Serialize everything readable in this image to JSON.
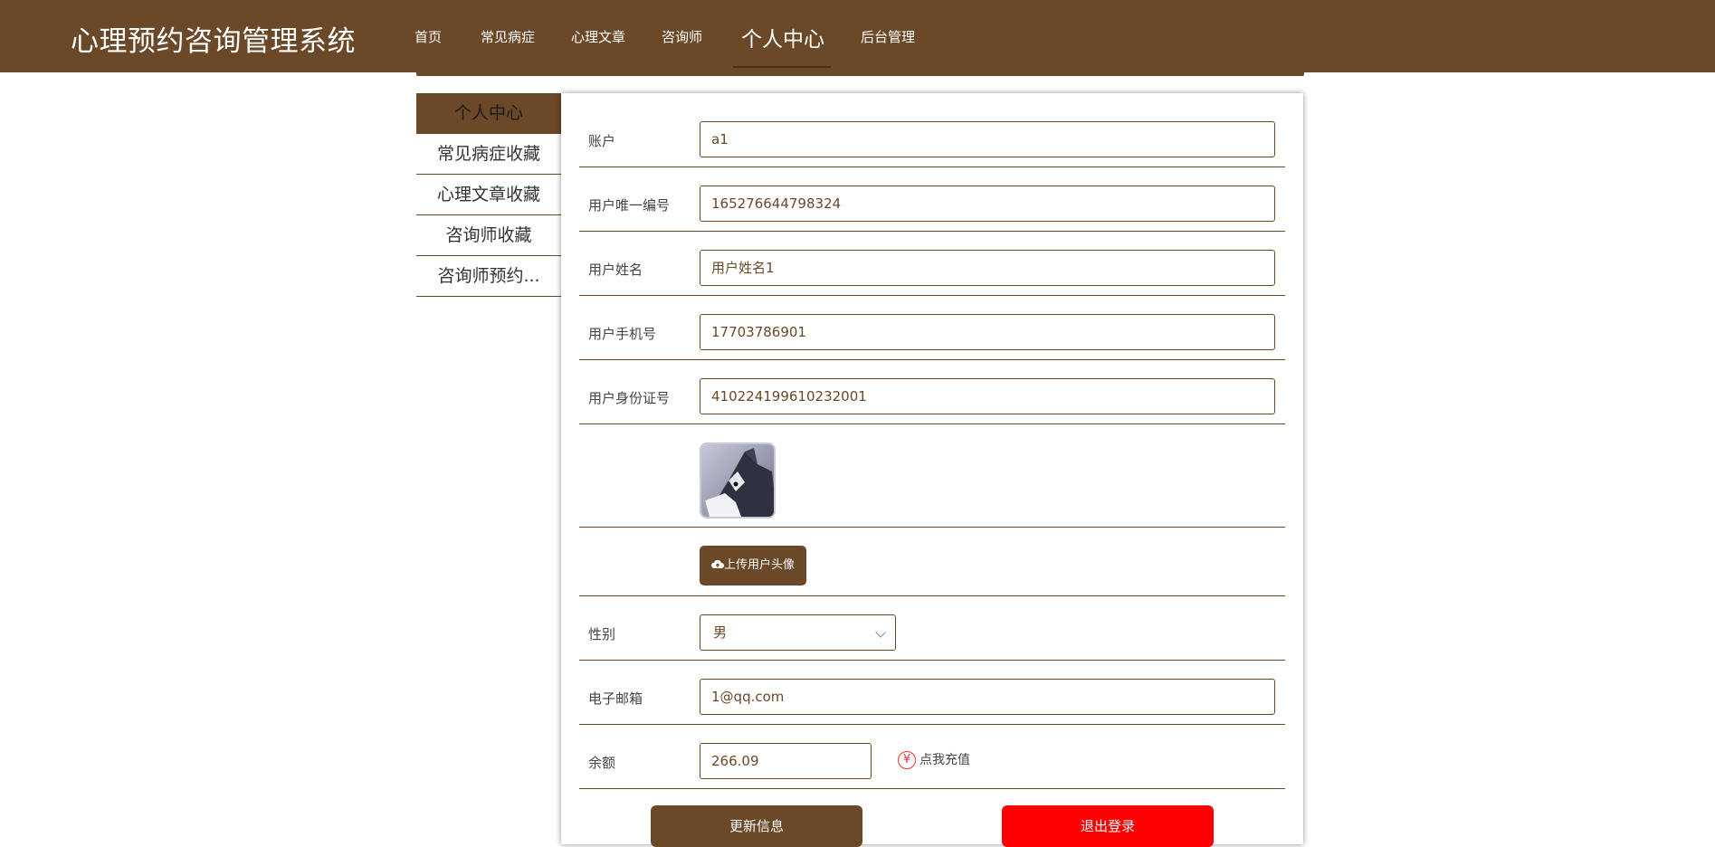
{
  "header": {
    "title": "心理预约咨询管理系统",
    "nav": [
      "首页",
      "常见病症",
      "心理文章",
      "咨询师",
      "个人中心",
      "后台管理"
    ],
    "active": "个人中心"
  },
  "sidebar": {
    "items": [
      {
        "label": "个人中心",
        "active": true
      },
      {
        "label": "常见病症收藏"
      },
      {
        "label": "心理文章收藏"
      },
      {
        "label": "咨询师收藏"
      },
      {
        "label": "咨询师预约..."
      }
    ]
  },
  "form": {
    "account": {
      "label": "账户",
      "value": "a1"
    },
    "user_id": {
      "label": "用户唯一编号",
      "value": "165276644798324"
    },
    "name": {
      "label": "用户姓名",
      "value": "用户姓名1"
    },
    "phone": {
      "label": "用户手机号",
      "value": "17703786901"
    },
    "id_card": {
      "label": "用户身份证号",
      "value": "410224199610232001"
    },
    "upload_label": "上传用户头像",
    "gender": {
      "label": "性别",
      "value": "男"
    },
    "email": {
      "label": "电子邮箱",
      "value": "1@qq.com"
    },
    "balance": {
      "label": "余额",
      "value": "266.09",
      "recharge": "点我充值",
      "currency_symbol": "¥"
    },
    "update_button": "更新信息",
    "logout_button": "退出登录"
  },
  "colors": {
    "brand": "#6b4827",
    "danger": "#ff0000"
  }
}
